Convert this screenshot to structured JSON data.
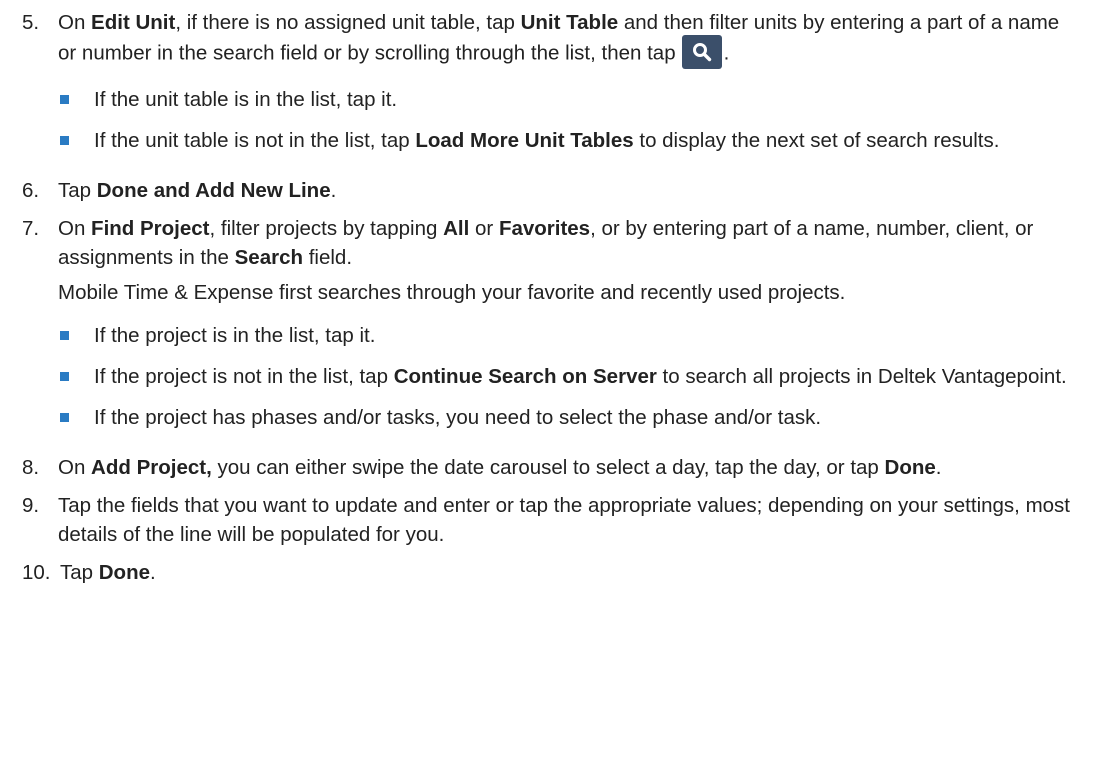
{
  "steps": [
    {
      "number": "5.",
      "parts": [
        "On ",
        "Edit Unit",
        ", if there is no assigned unit table, tap ",
        "Unit Table",
        " and then filter units by entering a part of a name or number in the search field or by scrolling through the list, then tap",
        "."
      ],
      "icon": "search-icon",
      "bullets": [
        {
          "parts": [
            "If the unit table is in the list, tap it."
          ]
        },
        {
          "parts": [
            "If the unit table is not in the list, tap ",
            "Load More Unit Tables",
            " to display the next set of search results."
          ]
        }
      ]
    },
    {
      "number": "6.",
      "parts": [
        "Tap ",
        "Done and Add New Line",
        "."
      ]
    },
    {
      "number": "7.",
      "parts": [
        "On ",
        "Find Project",
        ", filter projects by tapping ",
        "All",
        " or ",
        "Favorites",
        ", or by entering part of a name, number, client, or assignments in the ",
        "Search",
        " field."
      ],
      "note": "Mobile Time & Expense first searches through your favorite and recently used projects.",
      "bullets": [
        {
          "parts": [
            "If the project is in the list, tap it."
          ]
        },
        {
          "parts": [
            "If the project is not in the list, tap ",
            "Continue Search on Server",
            " to search all projects in Deltek Vantagepoint."
          ]
        },
        {
          "parts": [
            "If the project has phases and/or tasks, you need to select the phase and/or task."
          ]
        }
      ]
    },
    {
      "number": "8.",
      "parts": [
        "On ",
        "Add Project,",
        " you can either swipe the date carousel to select a day, tap the day, or tap ",
        "Done",
        "."
      ]
    },
    {
      "number": "9.",
      "parts": [
        "Tap the fields that you want to update and enter or tap the appropriate values; depending on your settings, most details of the line will be populated for you."
      ]
    },
    {
      "number": "10.",
      "parts": [
        "Tap ",
        "Done",
        "."
      ]
    }
  ],
  "colors": {
    "bullet": "#2a7bc3",
    "search_button_bg": "#3b4f6a",
    "text": "#222222"
  }
}
